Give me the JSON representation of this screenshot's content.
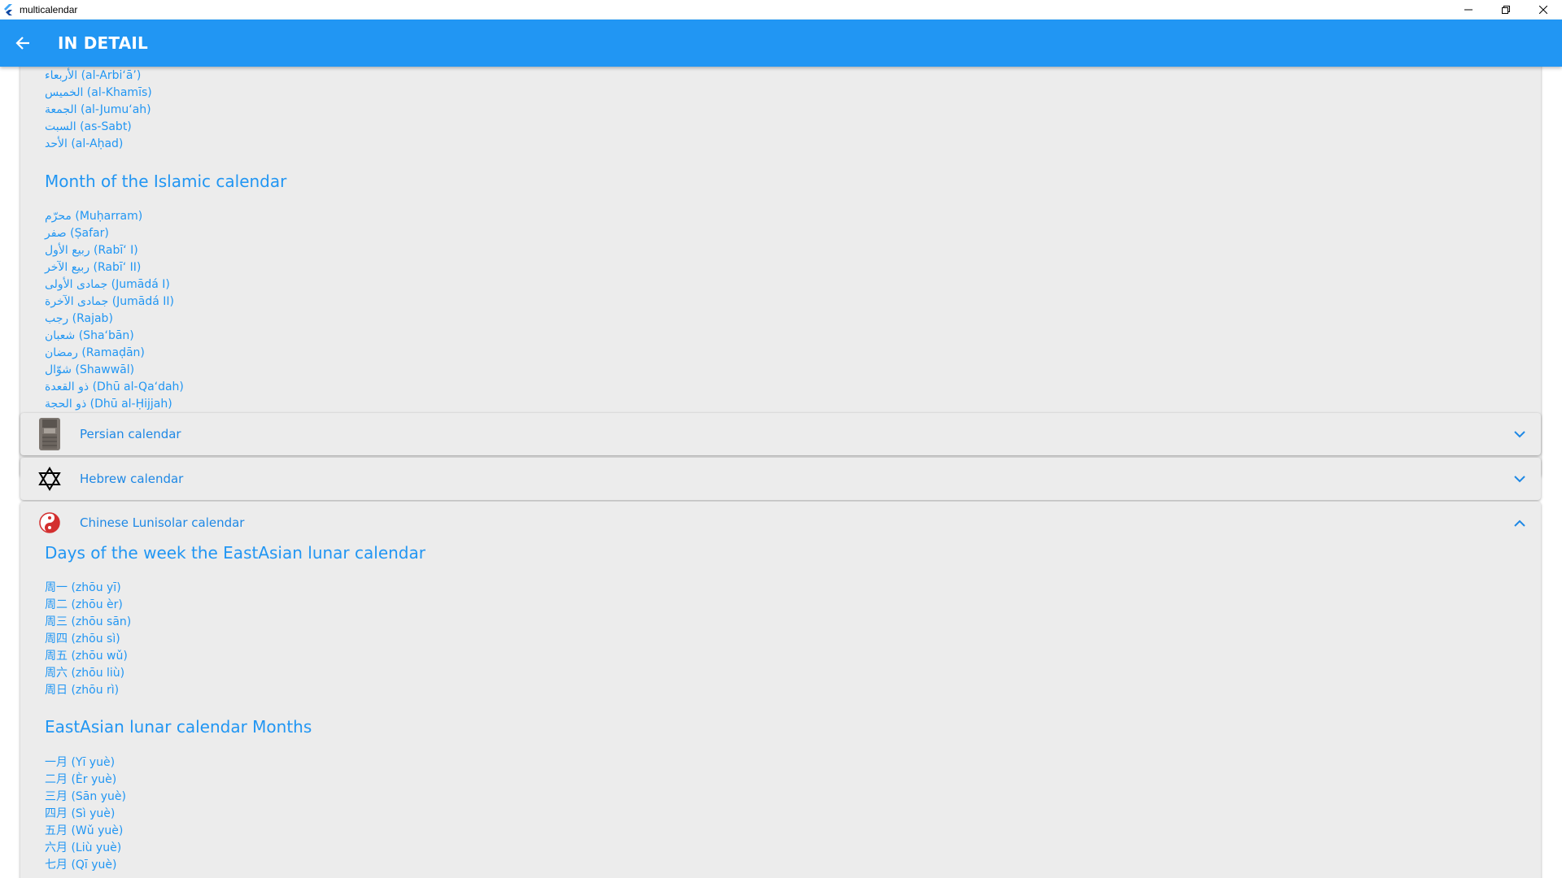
{
  "window": {
    "title": "multicalendar"
  },
  "appbar": {
    "title": "IN DETAIL"
  },
  "islamic": {
    "days_visible": [
      "الأربعاء (al-Arbi‘ā’)",
      "الخميس (al-Khamīs)",
      "الجمعة (al-Jumu‘ah)",
      "السبت (as-Sabt)",
      "الأحد (al-Aḥad)"
    ],
    "months_heading": "Month of the Islamic calendar",
    "months": [
      "محرّم (Muḥarram)",
      "صفر (Ṣafar)",
      "ربيع الأول (Rabī‘ I)",
      "ربيع الآخر (Rabī‘ II)",
      "جمادى الأولى (Jumādá I)",
      "جمادى الآخرة (Jumādá II)",
      "رجب (Rajab)",
      "شعبان (Sha‘bān)",
      "رمضان (Ramaḍān)",
      "شوّال (Shawwāl)",
      "ذو القعدة (Dhū al-Qa‘dah)",
      "ذو الحجة (Dhū al-Ḥijjah)"
    ]
  },
  "panels": {
    "persian": {
      "label": "Persian calendar",
      "icon": "persian-relief-icon",
      "expanded": false
    },
    "hebrew": {
      "label": "Hebrew calendar",
      "icon": "star-of-david-icon",
      "expanded": false
    },
    "chinese": {
      "label": "Chinese Lunisolar calendar",
      "icon": "yin-yang-icon",
      "expanded": true
    }
  },
  "chinese": {
    "days_heading": "Days of the week the EastAsian lunar calendar",
    "days": [
      "周一 (zhōu yī)",
      "周二 (zhōu èr)",
      "周三 (zhōu sān)",
      "周四 (zhōu sì)",
      "周五 (zhōu wǔ)",
      "周六 (zhōu liù)",
      "周日 (zhōu rì)"
    ],
    "months_heading": "EastAsian lunar calendar Months",
    "months_visible": [
      "一月 (Yī yuè)",
      "二月 (Èr yuè)",
      "三月 (Sān yuè)",
      "四月 (Sì yuè)",
      "五月 (Wǔ yuè)",
      "六月 (Liù yuè)",
      "七月 (Qī yuè)"
    ]
  },
  "colors": {
    "accent": "#2196f3",
    "card": "#ececec",
    "yin_yang_red": "#d32f2f"
  }
}
